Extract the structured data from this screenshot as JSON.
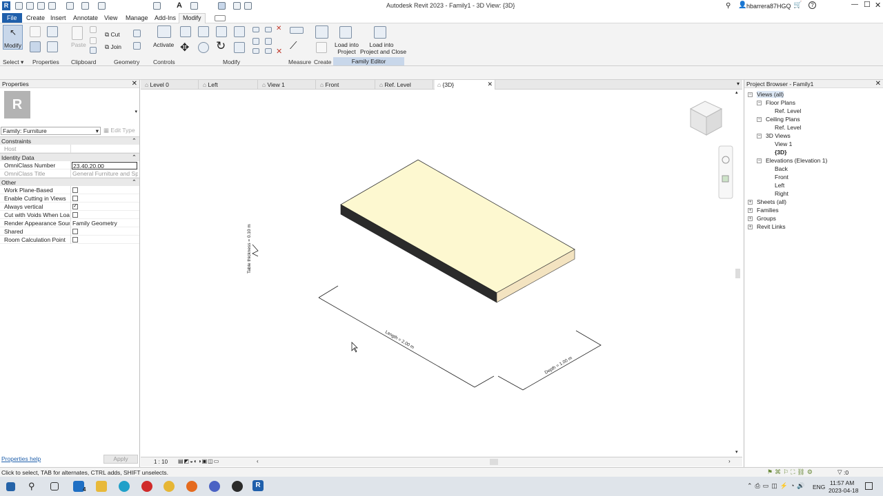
{
  "titlebar": {
    "title": "Autodesk Revit 2023 - Family1 - 3D View: {3D}",
    "user": "hbarrera87HGQ"
  },
  "ribbon_tabs": [
    "File",
    "Create",
    "Insert",
    "Annotate",
    "View",
    "Manage",
    "Add-Ins",
    "Modify"
  ],
  "ribbon": {
    "modify_label": "Modify",
    "cut_label": "Cut",
    "join_label": "Join",
    "paste_label": "Paste",
    "activate_label": "Activate",
    "load_project": "Load into\nProject",
    "load_project_close": "Load into\nProject and Close",
    "panels": {
      "select": "Select",
      "properties": "Properties",
      "clipboard": "Clipboard",
      "geometry": "Geometry",
      "controls": "Controls",
      "modify": "Modify",
      "measure": "Measure",
      "create": "Create",
      "family_editor": "Family Editor"
    }
  },
  "properties": {
    "title": "Properties",
    "type_selector": "Family: Furniture",
    "edit_type": "Edit Type",
    "sections": [
      {
        "name": "Constraints",
        "rows": [
          {
            "k": "Host",
            "v": "",
            "grey": true
          }
        ]
      },
      {
        "name": "Identity Data",
        "rows": [
          {
            "k": "OmniClass Number",
            "v": "23.40.20.00"
          },
          {
            "k": "OmniClass Title",
            "v": "General Furniture and Spe...",
            "grey": true
          }
        ]
      },
      {
        "name": "Other",
        "rows": [
          {
            "k": "Work Plane-Based",
            "cb": false
          },
          {
            "k": "Enable Cutting in Views",
            "cb": false
          },
          {
            "k": "Always vertical",
            "cb": true
          },
          {
            "k": "Cut with Voids When Loa...",
            "cb": false
          },
          {
            "k": "Render Appearance Source",
            "v": "Family Geometry"
          },
          {
            "k": "Shared",
            "cb": false
          },
          {
            "k": "Room Calculation Point",
            "cb": false
          }
        ]
      }
    ],
    "help": "Properties help",
    "apply": "Apply"
  },
  "view_tabs": [
    "Level 0",
    "Left",
    "View 1",
    "Front",
    "Ref. Level",
    "{3D}"
  ],
  "dimensions": {
    "thickness": "Table thickness = 0.10 m",
    "length": "Length = 2.00 m",
    "depth": "Depth = 1.00 m"
  },
  "viewbar": {
    "scale": "1 : 10"
  },
  "browser": {
    "title": "Project Browser - Family1",
    "nodes": [
      {
        "label": "Views (all)",
        "level": 0
      },
      {
        "label": "Floor Plans",
        "level": 1
      },
      {
        "label": "Ref. Level",
        "level": 2
      },
      {
        "label": "Ceiling Plans",
        "level": 1
      },
      {
        "label": "Ref. Level",
        "level": 2
      },
      {
        "label": "3D Views",
        "level": 1
      },
      {
        "label": "View 1",
        "level": 2
      },
      {
        "label": "{3D}",
        "level": 2,
        "bold": true
      },
      {
        "label": "Elevations (Elevation 1)",
        "level": 1
      },
      {
        "label": "Back",
        "level": 2
      },
      {
        "label": "Front",
        "level": 2
      },
      {
        "label": "Left",
        "level": 2
      },
      {
        "label": "Right",
        "level": 2
      },
      {
        "label": "Sheets (all)",
        "level": 0
      },
      {
        "label": "Families",
        "level": 0
      },
      {
        "label": "Groups",
        "level": 0
      },
      {
        "label": "Revit Links",
        "level": 0
      }
    ]
  },
  "status": {
    "hint": "Click to select, TAB for alternates, CTRL adds, SHIFT unselects.",
    "filter_count": ":0"
  },
  "taskbar": {
    "lang": "ENG",
    "time": "11:57 AM",
    "date": "2023-04-18",
    "notif": "4"
  },
  "colors": {
    "file_tab": "#1f5fab",
    "table_top": "#fdf8d0",
    "table_side": "#2b2b2b",
    "table_end": "#f3e3c0"
  }
}
